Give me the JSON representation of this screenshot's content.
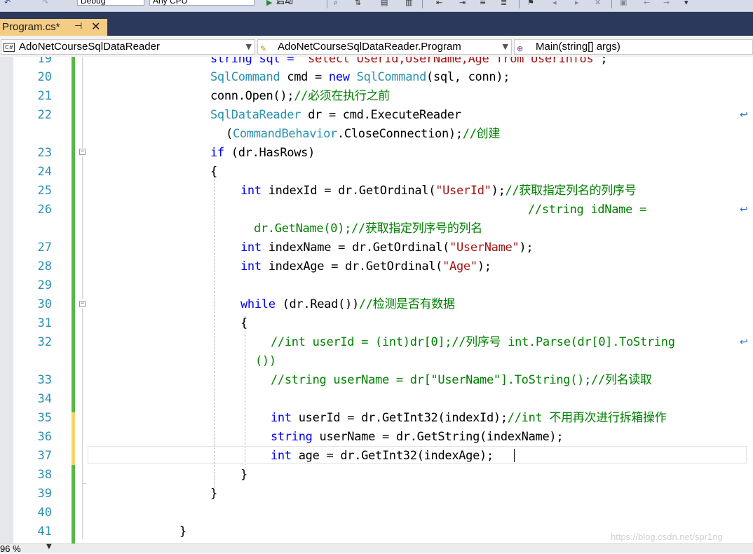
{
  "toolbar": {
    "config_combo": "Debug",
    "platform_combo": "Any CPU",
    "start_button": "启动",
    "icons": [
      "undo-icon",
      "start-icon",
      "find-icon",
      "split-icon",
      "comment-icon",
      "uncomment-icon",
      "bookmark-icon",
      "bookmark-prev-icon",
      "bookmark-next-icon",
      "format-icon",
      "overflow-icon"
    ]
  },
  "tab": {
    "title": "Program.cs*",
    "pin_icon": "⊣",
    "close_icon": "✕"
  },
  "navbar": {
    "project": "AdoNetCourseSqlDataReader",
    "type": "AdoNetCourseSqlDataReader.Program",
    "member": "Main(string[] args)"
  },
  "editor": {
    "lines": [
      {
        "n": "19",
        "text": "string sql = \"select UserId,UserName,Age from UserInfos\";"
      },
      {
        "n": "20",
        "text": "SqlCommand cmd = new SqlCommand(sql, conn);"
      },
      {
        "n": "21",
        "text": "conn.Open();//必须在执行之前"
      },
      {
        "n": "22",
        "text": "SqlDataReader dr = cmd.ExecuteReader(CommandBehavior.CloseConnection);//创建"
      },
      {
        "n": "23",
        "text": "if (dr.HasRows)"
      },
      {
        "n": "24",
        "text": "{"
      },
      {
        "n": "25",
        "text": "int indexId = dr.GetOrdinal(\"UserId\");//获取指定列名的列序号"
      },
      {
        "n": "26",
        "text": "//string idName = dr.GetName(0);//获取指定列序号的列名"
      },
      {
        "n": "27",
        "text": "int indexName = dr.GetOrdinal(\"UserName\");"
      },
      {
        "n": "28",
        "text": "int indexAge = dr.GetOrdinal(\"Age\");"
      },
      {
        "n": "29",
        "text": ""
      },
      {
        "n": "30",
        "text": "while (dr.Read())//检测是否有数据"
      },
      {
        "n": "31",
        "text": "{"
      },
      {
        "n": "32",
        "text": "//int userId = (int)dr[0];//列序号 int.Parse(dr[0].ToString())"
      },
      {
        "n": "33",
        "text": "//string userName = dr[\"UserName\"].ToString();//列名读取"
      },
      {
        "n": "34",
        "text": ""
      },
      {
        "n": "35",
        "text": "int userId = dr.GetInt32(indexId);//int 不用再次进行拆箱操作"
      },
      {
        "n": "36",
        "text": "string userName = dr.GetString(indexName);"
      },
      {
        "n": "37",
        "text": "int age = dr.GetInt32(indexAge);"
      },
      {
        "n": "38",
        "text": "}"
      },
      {
        "n": "39",
        "text": "}"
      },
      {
        "n": "40",
        "text": ""
      },
      {
        "n": "41",
        "text": "}"
      }
    ],
    "tok": {
      "l19_a": "string sql = ",
      "l19_b": "\"select UserId,UserName,Age from UserInfos\"",
      "l19_c": ";",
      "l20_a": "SqlCommand",
      "l20_b": " cmd = ",
      "l20_c": "new",
      "l20_d": " ",
      "l20_e": "SqlCommand",
      "l20_f": "(sql, conn);",
      "l21_a": "conn.Open();",
      "l21_b": "//必须在执行之前",
      "l22_a": "SqlDataReader",
      "l22_b": " dr = cmd.ExecuteReader",
      "l22w_a": "(",
      "l22w_b": "CommandBehavior",
      "l22w_c": ".CloseConnection);",
      "l22w_d": "//创建",
      "l23_a": "if",
      "l23_b": " (dr.HasRows)",
      "l24_a": "{",
      "l25_a": "int",
      "l25_b": " indexId = dr.GetOrdinal(",
      "l25_c": "\"UserId\"",
      "l25_d": ");",
      "l25_e": "//获取指定列名的列序号",
      "l26_a": "//string idName =",
      "l26w_a": "dr.GetName(0);//获取指定列序号的列名",
      "l27_a": "int",
      "l27_b": " indexName = dr.GetOrdinal(",
      "l27_c": "\"UserName\"",
      "l27_d": ");",
      "l28_a": "int",
      "l28_b": " indexAge = dr.GetOrdinal(",
      "l28_c": "\"Age\"",
      "l28_d": ");",
      "l30_a": "while",
      "l30_b": " (dr.Read())",
      "l30_c": "//检测是否有数据",
      "l31_a": "{",
      "l32_a": "//int userId = (int)dr[0];//列序号 int.Parse(dr[0].ToString",
      "l32w_a": "())",
      "l33_a": "//string userName = dr[\"UserName\"].ToString();//列名读取",
      "l35_a": "int",
      "l35_b": " userId = dr.GetInt32(indexId);",
      "l35_c": "//int 不用再次进行拆箱操作",
      "l36_a": "string",
      "l36_b": " userName = dr.GetString(indexName);",
      "l37_a": "int",
      "l37_b": " age = dr.GetInt32(indexAge);",
      "l38_a": "}",
      "l39_a": "}",
      "l41_a": "}"
    },
    "wrap_glyph": "↩",
    "change_colors": {
      "saved": "#57b846",
      "unsaved": "#f3d86b"
    }
  },
  "status": {
    "zoom": "96 %",
    "zoom_arrow": "▼"
  },
  "watermark": "https://blog.csdn.net/spr1ng"
}
